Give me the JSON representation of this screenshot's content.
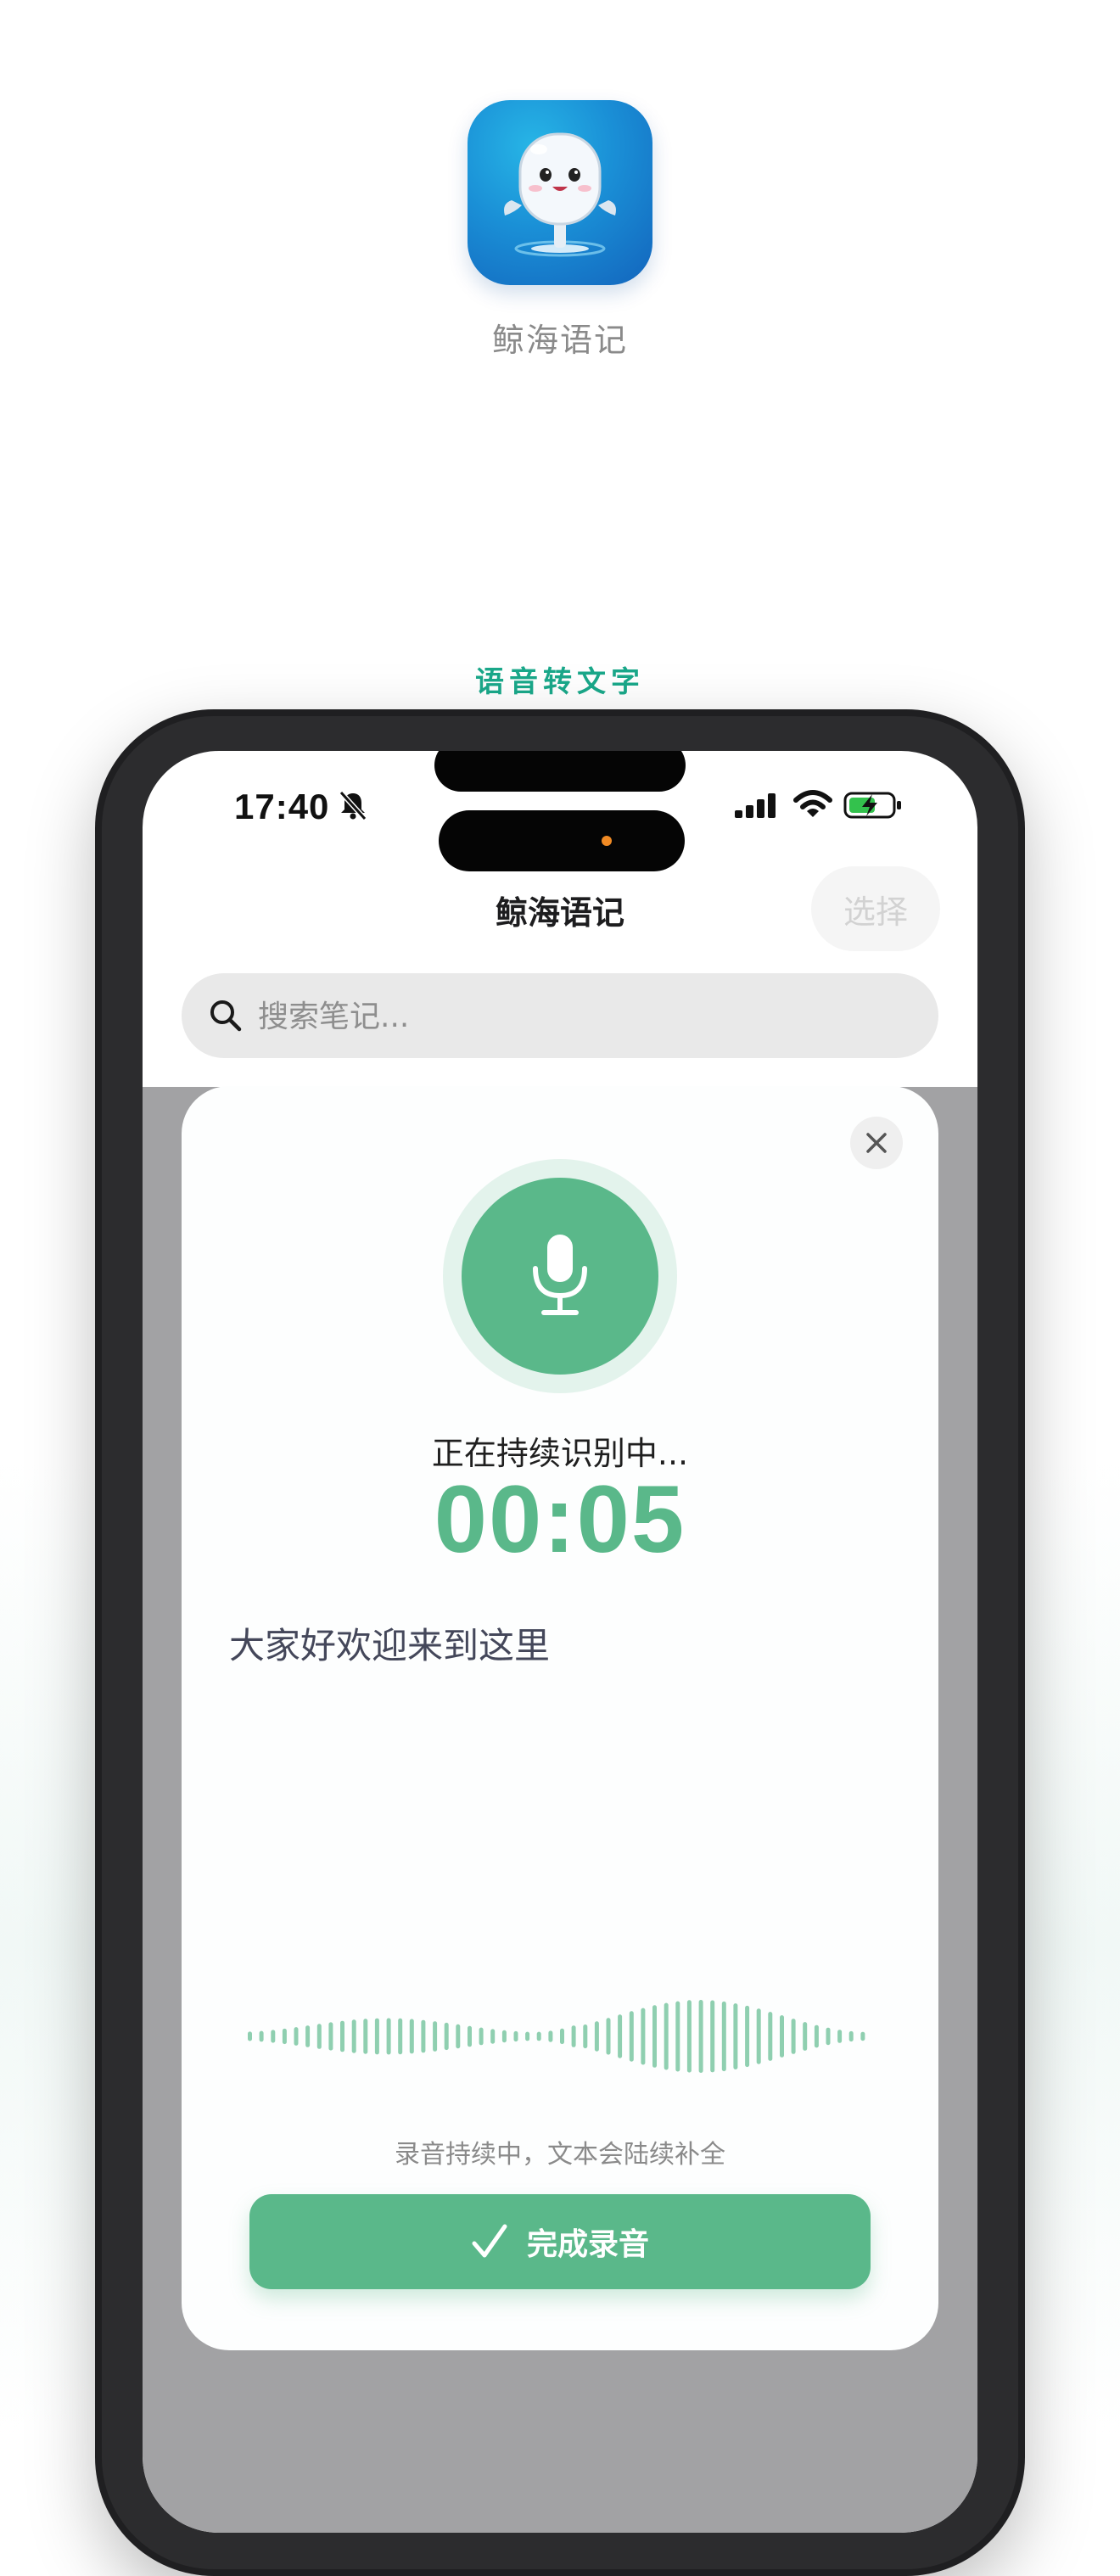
{
  "app": {
    "name": "鲸海语记"
  },
  "section": {
    "label": "语音转文字"
  },
  "status_bar": {
    "time": "17:40"
  },
  "nav": {
    "title": "鲸海语记",
    "select_label": "选择"
  },
  "search": {
    "placeholder": "搜索笔记..."
  },
  "recording": {
    "status": "正在持续识别中...",
    "timer": "00:05",
    "transcript": "大家好欢迎来到这里",
    "hint": "录音持续中，文本会陆续补全",
    "done_label": "完成录音"
  },
  "colors": {
    "accent": "#5ab88a",
    "section_label": "#1aa88a",
    "app_icon_blue": "#1a8fd6"
  }
}
